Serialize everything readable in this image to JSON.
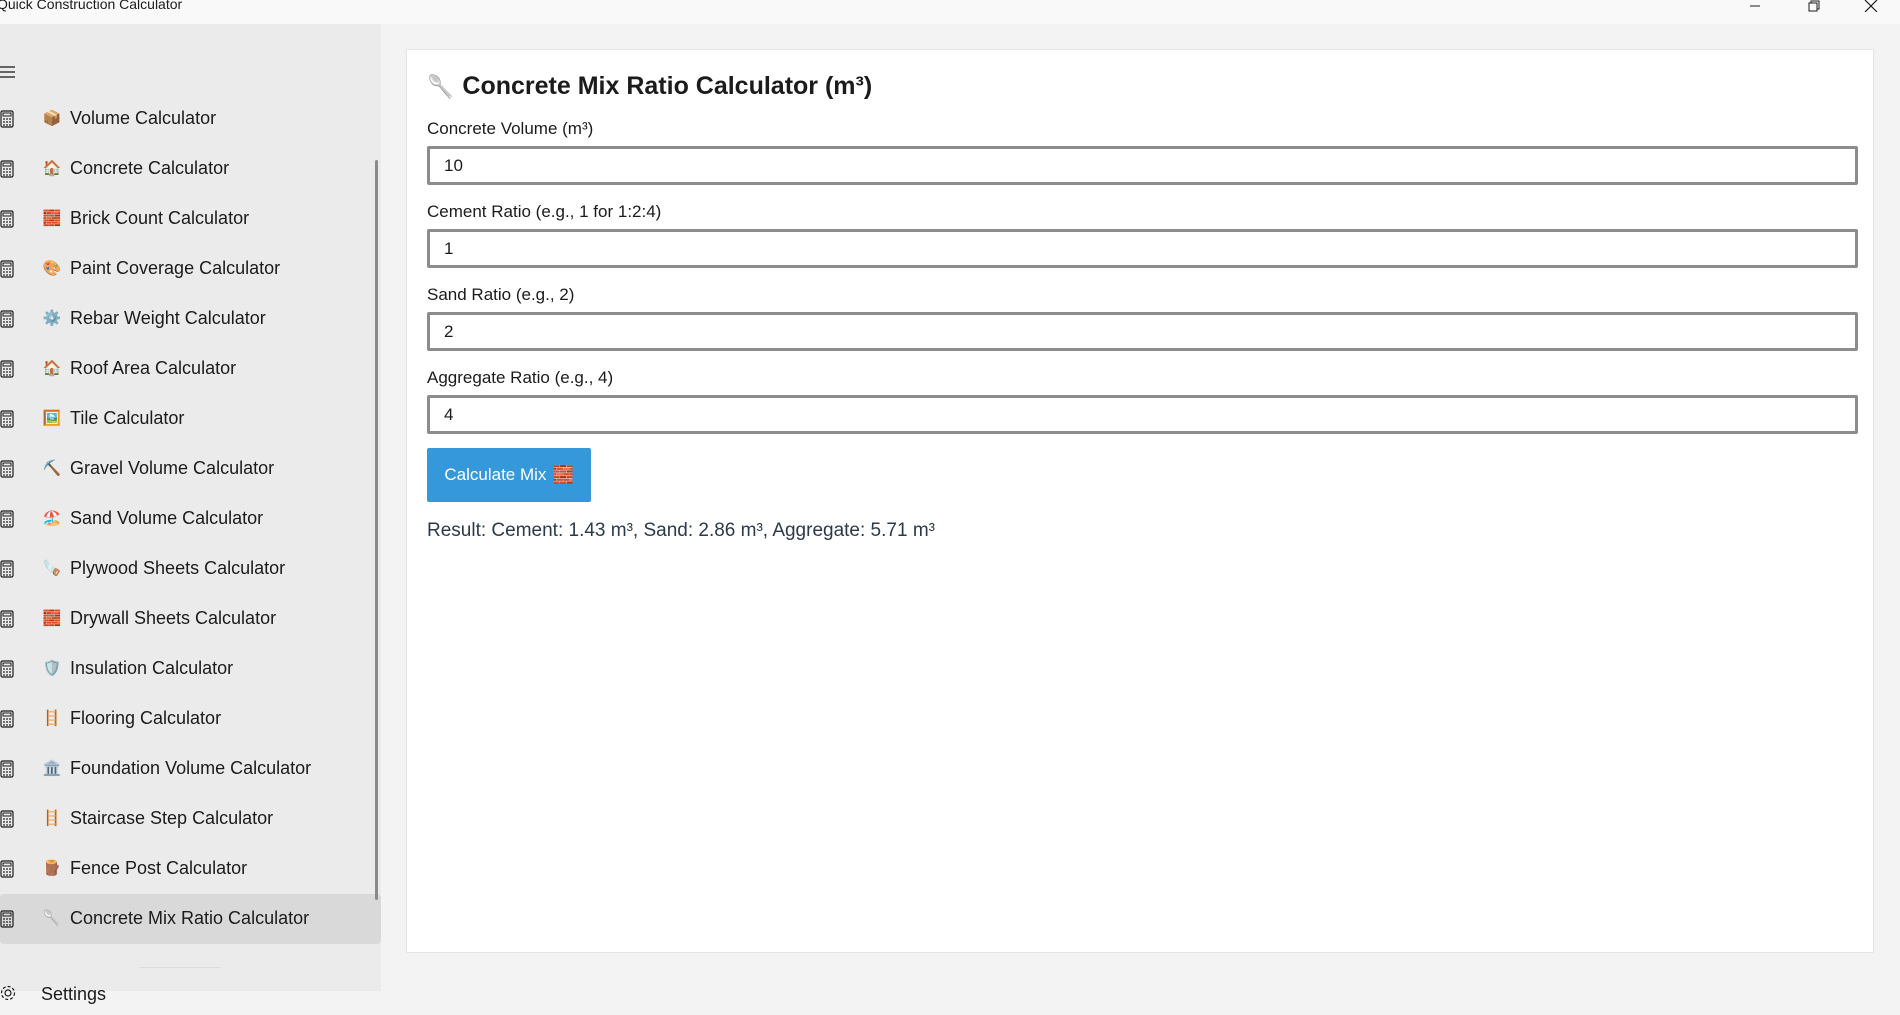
{
  "app": {
    "title": "Quick Construction Calculator"
  },
  "window_controls": {
    "minimize_icon": "minimize-icon",
    "maximize_icon": "restore-icon",
    "close_icon": "close-icon"
  },
  "sidebar": {
    "menu_icon": "hamburger-icon",
    "items": [
      {
        "label": "Volume Calculator",
        "emoji": "📦"
      },
      {
        "label": "Concrete Calculator",
        "emoji": "🏠"
      },
      {
        "label": "Brick Count Calculator",
        "emoji": "🧱"
      },
      {
        "label": "Paint Coverage Calculator",
        "emoji": "🎨"
      },
      {
        "label": "Rebar Weight Calculator",
        "emoji": "⚙️"
      },
      {
        "label": "Roof Area Calculator",
        "emoji": "🏠"
      },
      {
        "label": "Tile Calculator",
        "emoji": "🖼️"
      },
      {
        "label": "Gravel Volume Calculator",
        "emoji": "⛏️"
      },
      {
        "label": "Sand Volume Calculator",
        "emoji": "🏖️"
      },
      {
        "label": "Plywood Sheets Calculator",
        "emoji": "🪚"
      },
      {
        "label": "Drywall Sheets Calculator",
        "emoji": "🧱"
      },
      {
        "label": "Insulation Calculator",
        "emoji": "🛡️"
      },
      {
        "label": "Flooring Calculator",
        "emoji": "🪜"
      },
      {
        "label": "Foundation Volume Calculator",
        "emoji": "🏛️"
      },
      {
        "label": "Staircase Step Calculator",
        "emoji": "🪜"
      },
      {
        "label": "Fence Post Calculator",
        "emoji": "🪵"
      },
      {
        "label": "Concrete Mix Ratio Calculator",
        "emoji": "🥄"
      }
    ],
    "selected_index": 16,
    "settings_label": "Settings"
  },
  "main": {
    "title": "Concrete Mix Ratio Calculator (m³)",
    "title_emoji": "🥄",
    "fields": [
      {
        "label": "Concrete Volume (m³)",
        "value": "10"
      },
      {
        "label": "Cement Ratio (e.g., 1 for 1:2:4)",
        "value": "1"
      },
      {
        "label": "Sand Ratio (e.g., 2)",
        "value": "2"
      },
      {
        "label": "Aggregate Ratio (e.g., 4)",
        "value": "4"
      }
    ],
    "button_label": "Calculate Mix",
    "button_emoji": "🧱",
    "result": "Result: Cement: 1.43 m³, Sand: 2.86 m³, Aggregate: 5.71 m³"
  },
  "colors": {
    "accent": "#3498db",
    "sidebar_bg": "#ebebeb",
    "selected_bg": "#d9d9d9",
    "result_text": "#2b3a4a"
  }
}
